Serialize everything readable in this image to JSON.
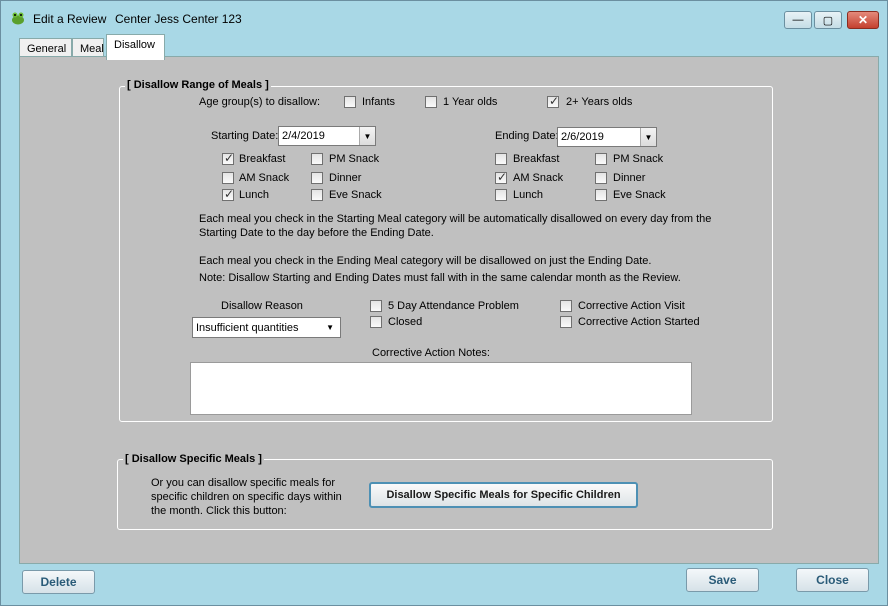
{
  "window": {
    "title": "Edit a Review",
    "subtitle": "Center Jess Center  123",
    "controls": {
      "minimize": "—",
      "maximize": "▢",
      "close": "✕"
    }
  },
  "tabs": [
    {
      "label": "General",
      "active": false
    },
    {
      "label": "Meal",
      "active": false
    },
    {
      "label": "Disallow",
      "active": true
    }
  ],
  "range_group": {
    "title": "[ Disallow Range of Meals ]",
    "age_label": "Age group(s) to disallow:",
    "ages": [
      {
        "label": "Infants",
        "checked": false
      },
      {
        "label": "1 Year olds",
        "checked": false
      },
      {
        "label": "2+ Years olds",
        "checked": true
      }
    ],
    "starting_date_label": "Starting Date:",
    "starting_date_value": "2/4/2019",
    "ending_date_label": "Ending Date:",
    "ending_date_value": "2/6/2019",
    "starting_meals": [
      {
        "label": "Breakfast",
        "checked": true
      },
      {
        "label": "PM Snack",
        "checked": false
      },
      {
        "label": "AM Snack",
        "checked": false
      },
      {
        "label": "Dinner",
        "checked": false
      },
      {
        "label": "Lunch",
        "checked": true
      },
      {
        "label": "Eve Snack",
        "checked": false
      }
    ],
    "ending_meals": [
      {
        "label": "Breakfast",
        "checked": false
      },
      {
        "label": "PM Snack",
        "checked": false
      },
      {
        "label": "AM Snack",
        "checked": true
      },
      {
        "label": "Dinner",
        "checked": false
      },
      {
        "label": "Lunch",
        "checked": false
      },
      {
        "label": "Eve Snack",
        "checked": false
      }
    ],
    "info_line1": "Each meal you check in the Starting Meal category will be automatically disallowed on every day from the",
    "info_line2": "Starting Date to the day before the Ending Date.",
    "info_line3": "Each meal you check in the Ending Meal category will be disallowed on just the Ending Date.",
    "info_line4": "Note: Disallow Starting and Ending Dates must fall with in the same calendar month as the Review.",
    "reason_label": "Disallow Reason",
    "reason_value": "Insufficient quantities",
    "reasons": [
      {
        "label": "5 Day Attendance Problem",
        "checked": false
      },
      {
        "label": "Closed",
        "checked": false
      },
      {
        "label": "Corrective Action Visit",
        "checked": false
      },
      {
        "label": "Corrective Action Started",
        "checked": false
      }
    ],
    "notes_label": "Corrective Action Notes:",
    "notes_value": ""
  },
  "specific_group": {
    "title": "[ Disallow Specific Meals ]",
    "text_line1": "Or you can disallow specific meals for",
    "text_line2": "specific children on specific days within",
    "text_line3": "the month.  Click this button:",
    "button_label": "Disallow Specific Meals for Specific Children"
  },
  "footer": {
    "delete_label": "Delete",
    "save_label": "Save",
    "close_label": "Close"
  },
  "colors": {
    "window_bg": "#a9d8e6",
    "panel_bg": "#c0c0c0",
    "accent": "#2a5b78"
  }
}
